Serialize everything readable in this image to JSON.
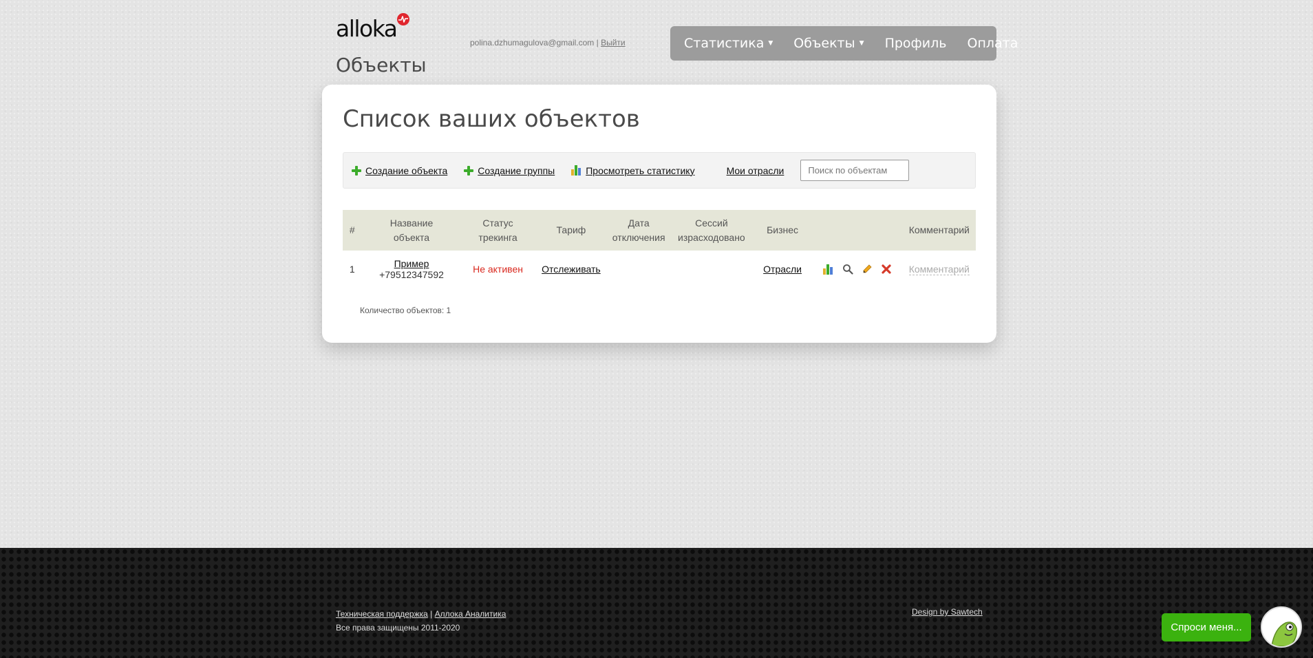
{
  "brand": {
    "logo_text": "alloka"
  },
  "header": {
    "page_heading": "Объекты",
    "user_email": "polina.dzhumagulova@gmail.com",
    "separator": "|",
    "logout_label": "Выйти"
  },
  "nav": {
    "items": [
      {
        "label": "Статистика",
        "caret": "▼"
      },
      {
        "label": "Объекты",
        "caret": "▼"
      },
      {
        "label": "Профиль"
      },
      {
        "label": "Оплата"
      }
    ]
  },
  "main": {
    "title": "Список ваших объектов",
    "toolbar": {
      "create_object": "Создание объекта",
      "create_group": "Создание группы",
      "view_stats": "Просмотреть статистику",
      "my_industries": "Мои отрасли",
      "search_placeholder": "Поиск по объектам"
    },
    "table": {
      "headers": {
        "num": "#",
        "name_1": "Название",
        "name_2": "объекта",
        "status_1": "Статус",
        "status_2": "трекинга",
        "tariff": "Тариф",
        "date_1": "Дата",
        "date_2": "отключения",
        "sessions_1": "Сессий",
        "sessions_2": "израсходовано",
        "business": "Бизнес",
        "actions": "",
        "comment": "Комментарий"
      },
      "rows": [
        {
          "num": "1",
          "name": "Пример",
          "phone": "+79512347592",
          "status": "Не активен",
          "tariff": "Отслеживать",
          "date": "",
          "sessions": "",
          "business": "Отрасли",
          "comment": "Комментарий"
        }
      ]
    },
    "count_text": "Количество объектов: 1"
  },
  "footer": {
    "support_link": "Техническая поддержка",
    "separator": "|",
    "analytics_link": "Аллока Аналитика",
    "copyright": "Все права защищены 2011-2020",
    "design_credit": "Design by Sawtech"
  },
  "chat": {
    "button_label": "Спроси меня..."
  },
  "colors": {
    "nav_bg": "#9c9c9c",
    "status_inactive": "#d9281e",
    "add_green": "#3cac2b",
    "chat_green": "#3bb20f",
    "table_header_bg": "#e5e6d8"
  }
}
